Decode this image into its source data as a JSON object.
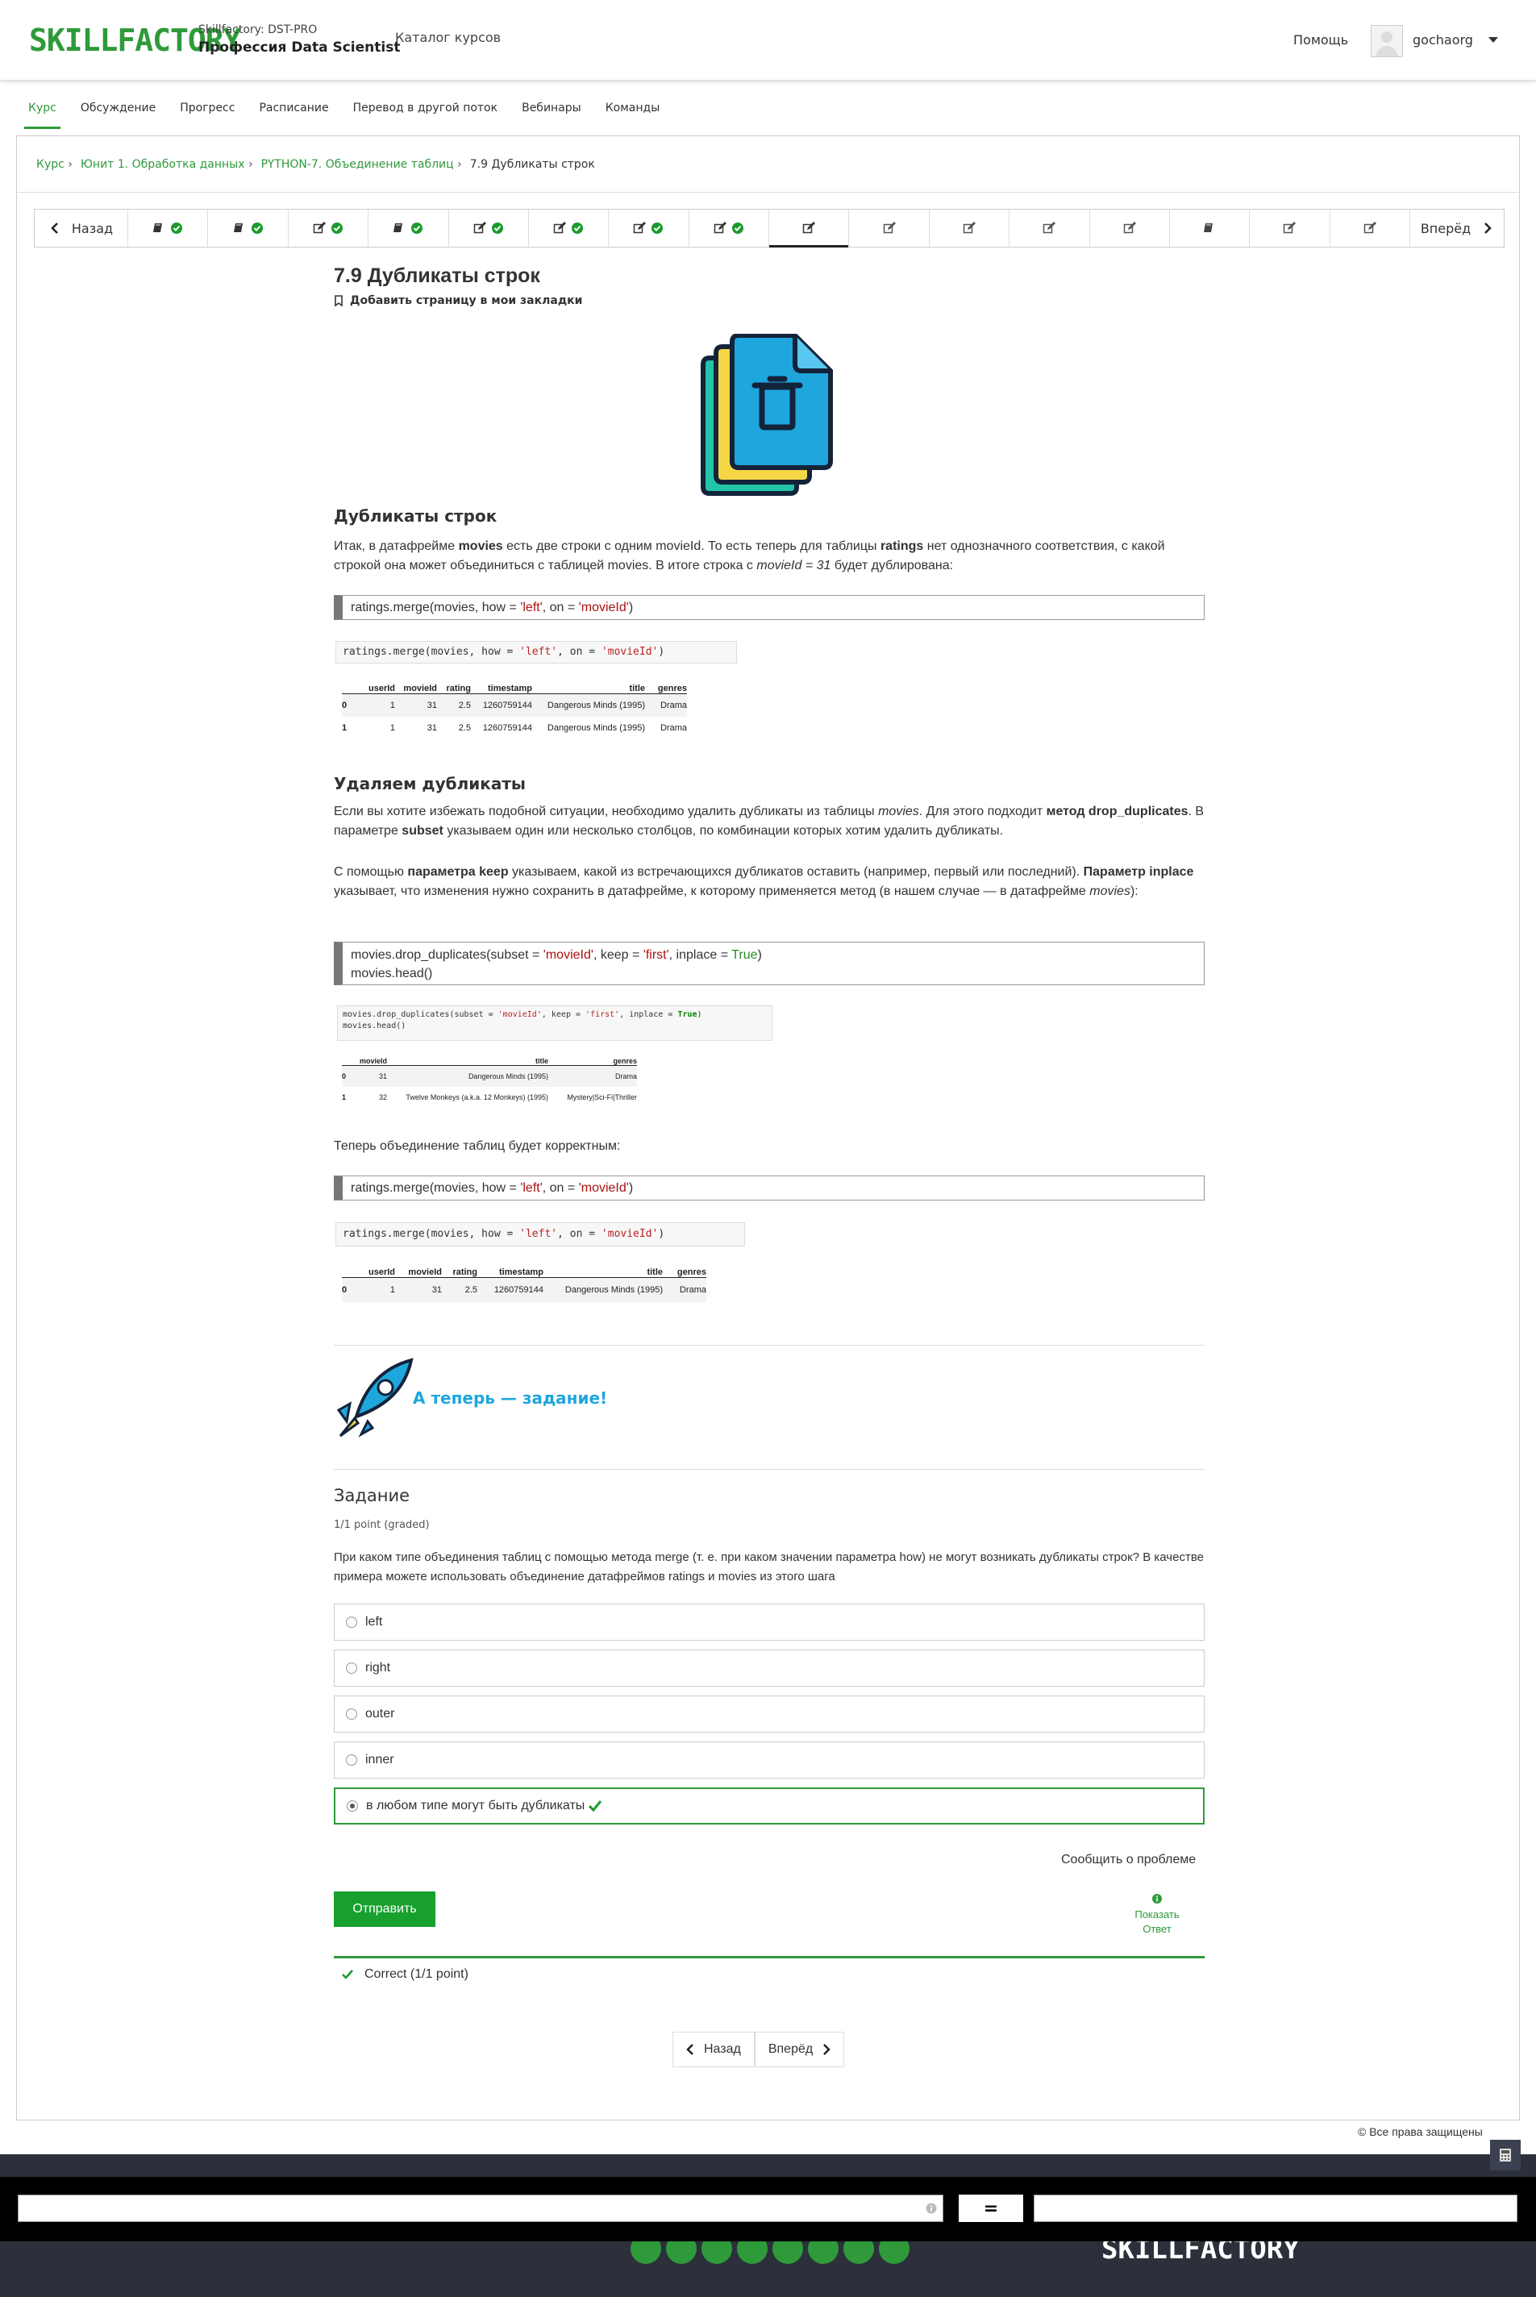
{
  "header": {
    "logo": "SKILLFACTORY",
    "org": "Skillfactory: DST-PRO",
    "course": "Профессия Data Scientist",
    "catalog": "Каталог курсов",
    "help": "Помощь",
    "username": "gochaorg"
  },
  "tabs": [
    "Курс",
    "Обсуждение",
    "Прогресс",
    "Расписание",
    "Перевод в другой поток",
    "Вебинары",
    "Команды"
  ],
  "breadcrumb": {
    "items": [
      "Курс",
      "Юнит 1. Обработка данных",
      "PYTHON-7. Объединение таблиц"
    ],
    "current": "7.9 Дубликаты строк"
  },
  "sequence": {
    "prev": "Назад",
    "next": "Вперёд"
  },
  "page": {
    "title": "7.9 Дубликаты строк",
    "bookmark": "Добавить страницу в мои закладки"
  },
  "section1": {
    "heading": "Дубликаты строк",
    "p1_a": "Итак, в датафрейме ",
    "p1_b": "movies",
    "p1_c": " есть две строки с одним movieId. То есть теперь для таблицы ",
    "p1_d": "ratings",
    "p1_e": " нет однозначного соответствия, с какой строкой она может объединиться с таблицей movies. В итоге строка с ",
    "p1_f": "movieId = 31",
    "p1_g": " будет дублирована:",
    "code": "ratings.merge(movies, how = 'left', on = 'movieId')"
  },
  "table1": {
    "headers": [
      "",
      "userId",
      "movieId",
      "rating",
      "timestamp",
      "title",
      "genres"
    ],
    "rows": [
      [
        "0",
        "1",
        "31",
        "2.5",
        "1260759144",
        "Dangerous Minds (1995)",
        "Drama"
      ],
      [
        "1",
        "1",
        "31",
        "2.5",
        "1260759144",
        "Dangerous Minds (1995)",
        "Drama"
      ]
    ]
  },
  "section2": {
    "heading": "Удаляем дубликаты",
    "p1_a": "Если вы хотите избежать подобной ситуации, необходимо удалить дубликаты из таблицы ",
    "p1_b": "movies",
    "p1_c": ". Для этого подходит ",
    "p1_d": "метод drop_duplicates",
    "p1_e": ". В параметре ",
    "p1_f": "subset",
    "p1_g": " указываем один или несколько столбцов, по комбинации которых хотим удалить дубликаты.",
    "p2_a": "С помощью ",
    "p2_b": "параметра keep",
    "p2_c": " указываем, какой из встречающихся дубликатов оставить (например, первый или последний). ",
    "p2_d": "Параметр inplace",
    "p2_e": " указывает, что изменения нужно сохранить в датафрейме, к которому применяется метод (в нашем случае — в датафрейме ",
    "p2_f": "movies",
    "p2_g": "):",
    "code1": "movies.drop_duplicates(subset = 'movieId', keep = 'first', inplace = True)",
    "code2": "movies.head()"
  },
  "table2": {
    "headers": [
      "",
      "movieId",
      "title",
      "genres"
    ],
    "rows": [
      [
        "0",
        "31",
        "Dangerous Minds (1995)",
        "Drama"
      ],
      [
        "1",
        "32",
        "Twelve Monkeys (a.k.a. 12 Monkeys) (1995)",
        "Mystery|Sci-Fi|Thriller"
      ]
    ]
  },
  "section3": {
    "p": "Теперь объединение таблиц будет корректным:",
    "code": "ratings.merge(movies, how = 'left', on = 'movieId')"
  },
  "table3": {
    "headers": [
      "",
      "userId",
      "movieId",
      "rating",
      "timestamp",
      "title",
      "genres"
    ],
    "rows": [
      [
        "0",
        "1",
        "31",
        "2.5",
        "1260759144",
        "Dangerous Minds (1995)",
        "Drama"
      ]
    ]
  },
  "task_banner": "А теперь — задание!",
  "problem": {
    "title": "Задание",
    "points": "1/1 point (graded)",
    "question": "При каком типе объединения таблиц с помощью метода merge (т. е. при каком значении параметра how) не могут возникать дубликаты строк? В качестве примера можете использовать объединение датафреймов ratings и movies из этого шага",
    "options": [
      "left",
      "right",
      "outer",
      "inner",
      "в любом типе могут быть дубликаты"
    ],
    "selected": 4,
    "report": "Сообщить о проблеме",
    "submit": "Отправить",
    "show_answer_1": "Показать",
    "show_answer_2": "Ответ",
    "result": "Correct (1/1 point)"
  },
  "bottom_nav": {
    "prev": "Назад",
    "next": "Вперёд"
  },
  "rights": "© Все права защищены",
  "footer": {
    "logo": "SKILLFACTORY",
    "equals": "="
  },
  "colors": {
    "brand": "#2f9a3a",
    "accent": "#1ea6dd",
    "footer": "#2b303b"
  }
}
